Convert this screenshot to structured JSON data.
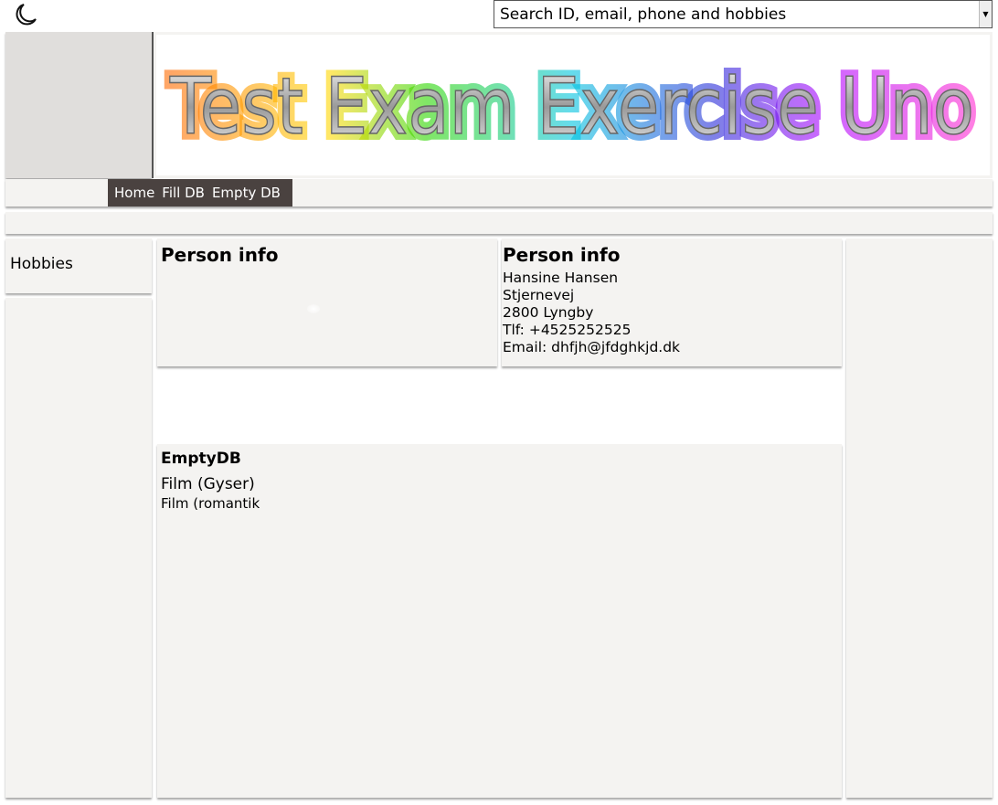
{
  "header": {
    "theme_toggle_icon": "moon-icon",
    "search": {
      "selected": "Search ID, email, phone and hobbies"
    }
  },
  "banner": {
    "title": "Test Exam Exercise Uno",
    "colors": [
      "#ff6a00",
      "#ffd800",
      "#2bd600",
      "#00c4e0",
      "#2a2ad8",
      "#b000ff",
      "#ff2ad0"
    ]
  },
  "nav": {
    "items": [
      "Home",
      "Fill DB",
      "Empty DB"
    ],
    "bg": "#4a4240"
  },
  "sidebar": {
    "hobbies_label": "Hobbies"
  },
  "person_left": {
    "title": "Person info"
  },
  "person_right": {
    "title": "Person info",
    "name": "Hansine Hansen",
    "street": "Stjernevej",
    "city": "2800 Lyngby",
    "phone": "Tlf: +4525252525",
    "email": "Email: dhfjh@jfdghkjd.dk"
  },
  "emptydb": {
    "title": "EmptyDB",
    "hobbies": [
      "Film  (Gyser)",
      "Film (romantik"
    ]
  }
}
